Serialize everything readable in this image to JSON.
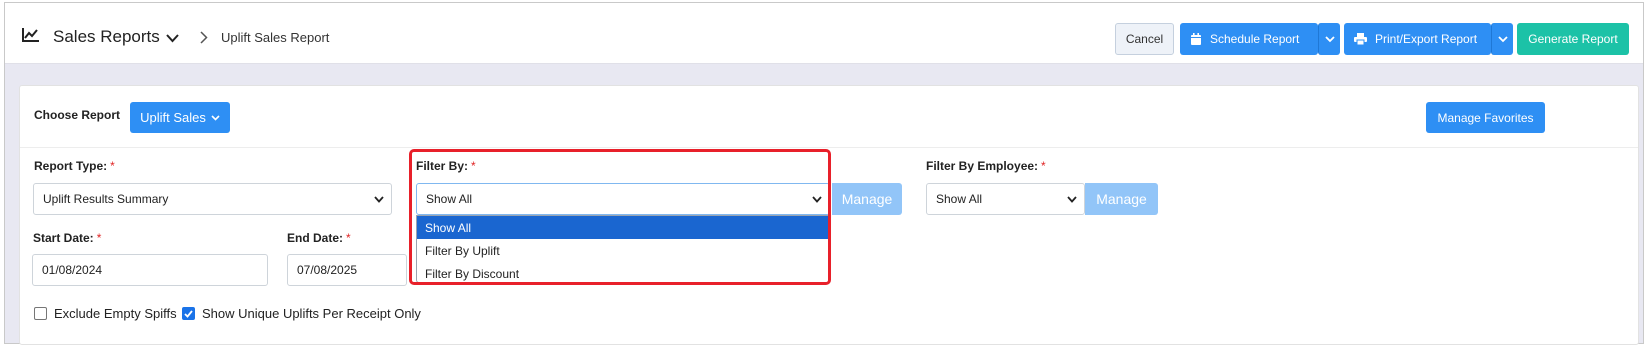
{
  "header": {
    "title": "Sales Reports",
    "breadcrumb": "Uplift Sales Report",
    "buttons": {
      "cancel": "Cancel",
      "schedule": "Schedule Report",
      "print": "Print/Export Report",
      "generate": "Generate Report"
    }
  },
  "card": {
    "choose_label": "Choose Report",
    "report_button": "Uplift Sales",
    "manage_favorites": "Manage Favorites",
    "report_type": {
      "label": "Report Type:",
      "value": "Uplift Results Summary"
    },
    "filter_by": {
      "label": "Filter By:",
      "value": "Show All",
      "manage": "Manage",
      "options": [
        "Show All",
        "Filter By Uplift",
        "Filter By Discount"
      ],
      "selected_index": 0
    },
    "filter_employee": {
      "label": "Filter By Employee:",
      "value": "Show All",
      "manage": "Manage"
    },
    "start_date": {
      "label": "Start Date:",
      "value": "01/08/2024"
    },
    "end_date": {
      "label": "End Date:",
      "value": "07/08/2025"
    },
    "required_mark": "*",
    "checkboxes": [
      {
        "label": "Exclude Empty Spiffs",
        "checked": false
      },
      {
        "label": "Show Unique Uplifts Per Receipt Only",
        "checked": true
      }
    ]
  },
  "colors": {
    "primary": "#2e8ff4",
    "success": "#1cc2a7",
    "highlight": "#e8202a",
    "dropdown_selected": "#1a66d0"
  }
}
